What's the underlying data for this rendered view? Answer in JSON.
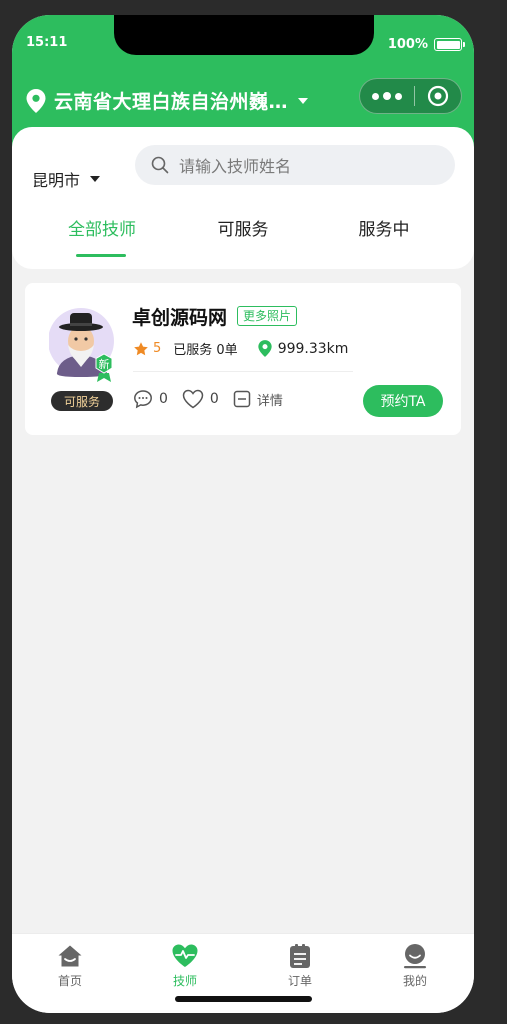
{
  "status_bar": {
    "time": "15:11",
    "battery": "100%"
  },
  "header": {
    "location": "云南省大理白族自治州巍…"
  },
  "capsule": {
    "more_icon": "dots-icon",
    "close_icon": "target-icon"
  },
  "filter": {
    "city": "昆明市",
    "search_placeholder": "请输入技师姓名"
  },
  "tabs": [
    {
      "label": "全部技师",
      "active": true
    },
    {
      "label": "可服务",
      "active": false
    },
    {
      "label": "服务中",
      "active": false
    }
  ],
  "technician": {
    "name": "卓创源码网",
    "more_photos": "更多照片",
    "new_badge": "新",
    "status": "可服务",
    "rating": "5",
    "served": "已服务 0单",
    "distance": "999.33km",
    "comments": "0",
    "likes": "0",
    "detail": "详情",
    "book": "预约TA"
  },
  "nav": [
    {
      "label": "首页",
      "icon": "home-icon",
      "active": false
    },
    {
      "label": "技师",
      "icon": "heart-pulse-icon",
      "active": true
    },
    {
      "label": "订单",
      "icon": "order-icon",
      "active": false
    },
    {
      "label": "我的",
      "icon": "user-icon",
      "active": false
    }
  ],
  "colors": {
    "brand": "#2dbd5e",
    "rating": "#ef8a24",
    "badge_bg": "#2d2d2d",
    "badge_text": "#f3d39a"
  }
}
